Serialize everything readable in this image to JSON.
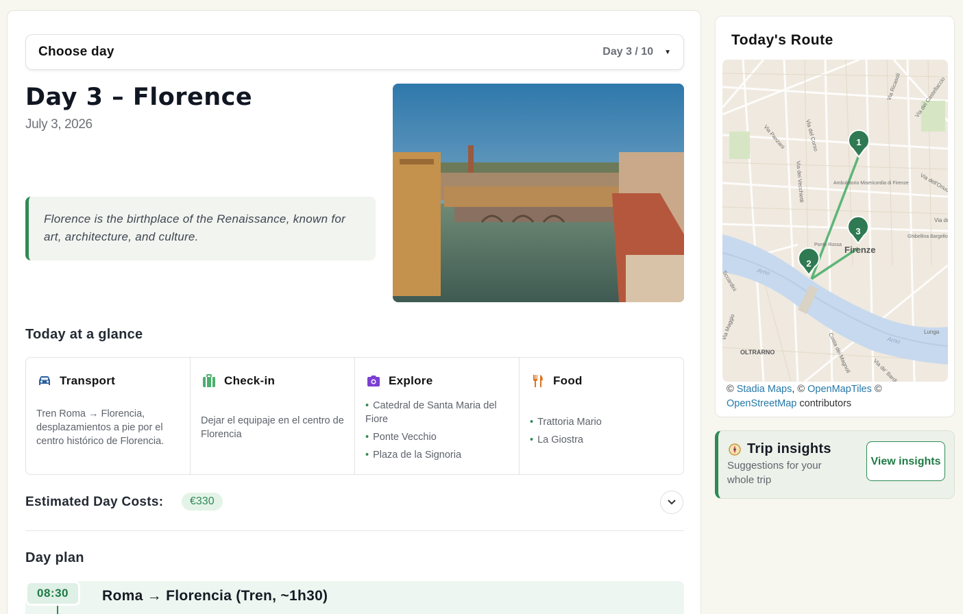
{
  "day_selector": {
    "label": "Choose day",
    "value": "Day 3 / 10"
  },
  "day": {
    "title": "Day 3 – Florence",
    "date": "July 3, 2026",
    "quote": "Florence is the birthplace of the Renaissance, known for art, architecture, and culture."
  },
  "glance": {
    "title": "Today at a glance",
    "transport": {
      "label": "Transport",
      "text": "Tren Roma → Florencia, desplazamientos a pie por el centro histórico de Florencia."
    },
    "checkin": {
      "label": "Check-in",
      "text": "Dejar el equipaje en el centro de Florencia"
    },
    "explore": {
      "label": "Explore",
      "items": [
        "Catedral de Santa Maria del Fiore",
        "Ponte Vecchio",
        "Plaza de la Signoria"
      ]
    },
    "food": {
      "label": "Food",
      "items": [
        "Trattoria Mario",
        "La Giostra"
      ]
    }
  },
  "costs": {
    "label": "Estimated Day Costs:",
    "amount": "€330"
  },
  "plan": {
    "title": "Day plan",
    "items": [
      {
        "time": "08:30",
        "title": "Roma → Florencia (Tren, ~1h30)"
      }
    ]
  },
  "route": {
    "title": "Today's Route",
    "markers": [
      "1",
      "2",
      "3"
    ],
    "map_labels": {
      "city": "Firenze",
      "district": "OLTRARNO",
      "ambulatorio": "Ambulatorio Misericordia di Firenze",
      "ponte": "Ponte Rossa",
      "ghibellina": "Ghibellina Bargello",
      "arno": "Arno",
      "lunga": "Lunga",
      "via_pucci": "Via Panzani",
      "via_corso": "Via del Corso",
      "via_vecchietti": "Via dei Vecchietti",
      "via_ricasoli": "Via Ricasoli",
      "via_castellaccio": "Via del Castellaccio",
      "via_oriuolo": "Via dell'Oriuolo",
      "via_maggio": "Via Maggio",
      "costa": "Costa dei Magnoli",
      "via_bardi": "Via de' Bardi",
      "via_p": "Via del P",
      "scardini": "Sccardini"
    },
    "attribution": {
      "copy1": "© ",
      "stadia": "Stadia Maps",
      "copy2": ", © ",
      "omt": "OpenMapTiles",
      "copy3": " © ",
      "osm": "OpenStreetMap",
      "contributors": " contributors"
    }
  },
  "insights": {
    "title": "Trip insights",
    "subtitle": "Suggestions for your whole trip",
    "button": "View insights"
  },
  "colors": {
    "accent": "#2f8a55",
    "explore_icon": "#7b3fd1",
    "food_icon": "#e0731f",
    "transport_icon": "#2c5f9e",
    "checkin_icon": "#4caf6d"
  }
}
